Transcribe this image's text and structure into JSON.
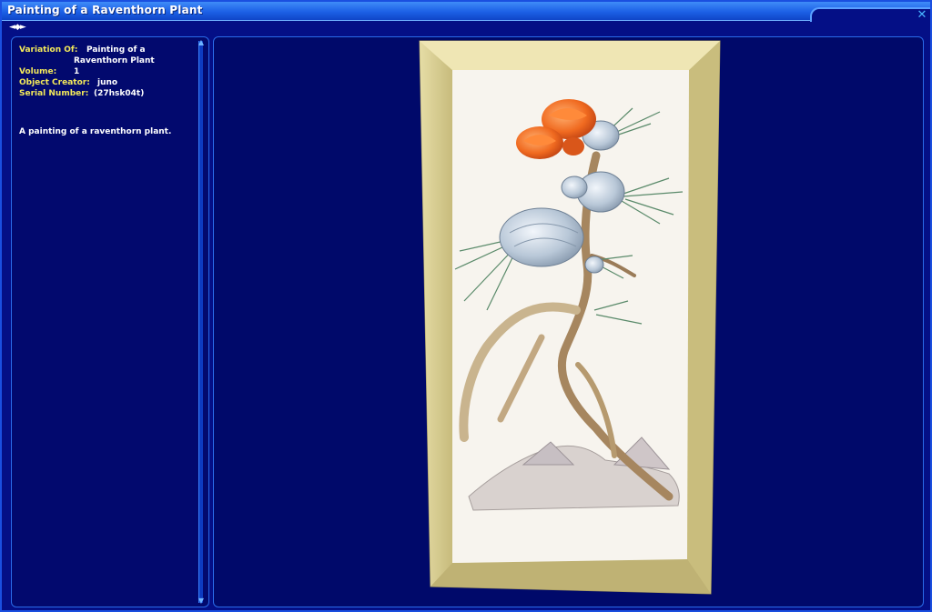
{
  "window": {
    "title": "Painting of a Raventhorn Plant",
    "close_glyph": "✕"
  },
  "nav": {
    "left_glyph": "◄",
    "mid_glyph": "◆",
    "right_glyph": "►"
  },
  "info": {
    "variation_label": "Variation Of:",
    "variation_value_line1": "Painting of a",
    "variation_value_line2": "Raventhorn Plant",
    "volume_label": "Volume:",
    "volume_value": "1",
    "creator_label": "Object Creator:",
    "creator_value": "juno",
    "serial_label": "Serial Number:",
    "serial_value": "(27hsk04t)"
  },
  "description": "A painting of a raventhorn plant.",
  "icons": {
    "close": "close-icon",
    "scroll_up": "scroll-up-arrow-icon",
    "scroll_down": "scroll-down-arrow-icon",
    "nav": "navigation-arrows-icon"
  },
  "colors": {
    "label": "#f2e85a",
    "value": "#ffffff",
    "title_bar": "#1c60e6",
    "panel_border": "#2a6be8",
    "background": "#040f86"
  }
}
